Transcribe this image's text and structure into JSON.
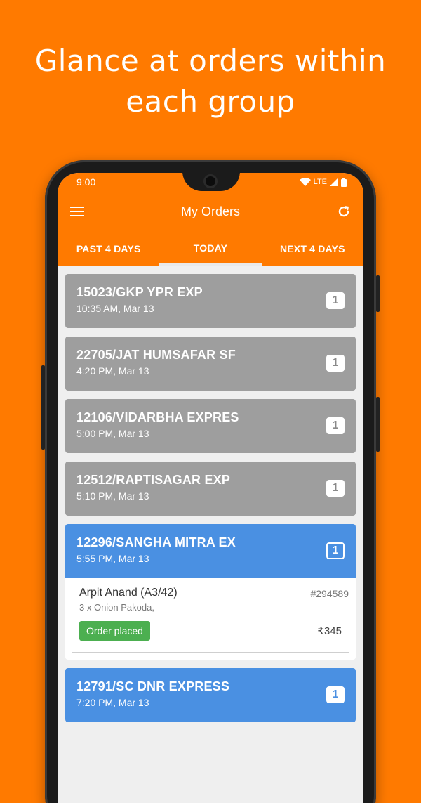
{
  "headline": {
    "line1": "Glance at orders within",
    "line2": "each group"
  },
  "status_bar": {
    "time": "9:00",
    "network": "LTE"
  },
  "app_bar": {
    "title": "My Orders",
    "menu_icon": "hamburger-menu-icon",
    "refresh_icon": "refresh-icon"
  },
  "tabs": [
    {
      "label": "PAST 4 DAYS",
      "active": false
    },
    {
      "label": "TODAY",
      "active": true
    },
    {
      "label": "NEXT 4 DAYS",
      "active": false
    }
  ],
  "orders": [
    {
      "train": "15023/GKP YPR EXP",
      "time": "10:35 AM, Mar 13",
      "count": "1",
      "color": "#9e9e9e"
    },
    {
      "train": "22705/JAT HUMSAFAR SF",
      "time": "4:20 PM, Mar 13",
      "count": "1",
      "color": "#9e9e9e"
    },
    {
      "train": "12106/VIDARBHA EXPRES",
      "time": "5:00 PM, Mar 13",
      "count": "1",
      "color": "#9e9e9e"
    },
    {
      "train": "12512/RAPTISAGAR EXP",
      "time": "5:10 PM, Mar 13",
      "count": "1",
      "color": "#9e9e9e"
    },
    {
      "train": "12296/SANGHA MITRA EX",
      "time": "5:55 PM, Mar 13",
      "count": "1",
      "color": "#4a90e2",
      "expanded": {
        "customer": "Arpit Anand (A3/42)",
        "order_id": "#294589",
        "items": "3 x Onion Pakoda,",
        "status": "Order placed",
        "price": "₹345"
      }
    },
    {
      "train": "12791/SC DNR EXPRESS",
      "time": "7:20 PM, Mar 13",
      "count": "1",
      "color": "#4a90e2"
    }
  ],
  "colors": {
    "background": "#ff7a00",
    "grey_card": "#9e9e9e",
    "blue_card": "#4a90e2",
    "status_green": "#4caf50"
  }
}
